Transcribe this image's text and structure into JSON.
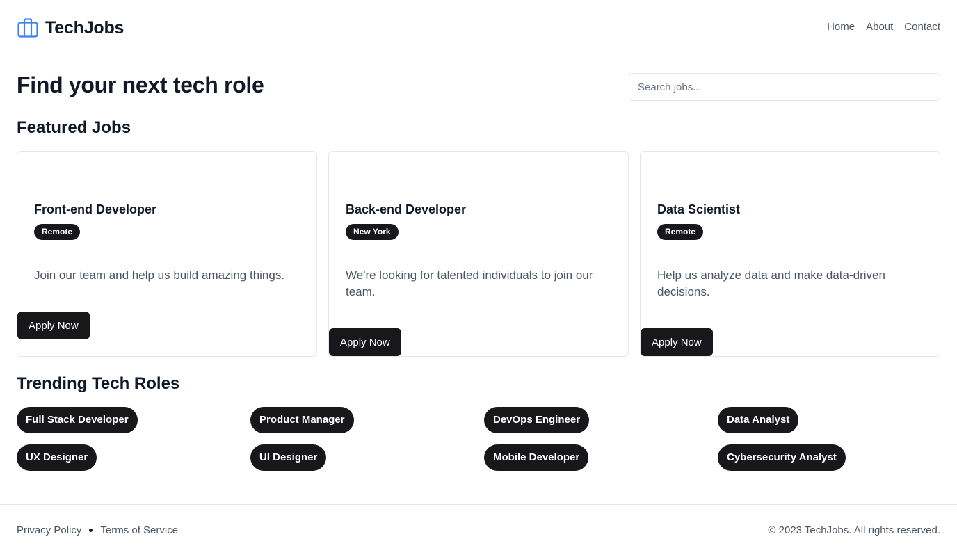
{
  "header": {
    "brand": "TechJobs",
    "brand_icon": "briefcase-icon",
    "nav": [
      "Home",
      "About",
      "Contact"
    ]
  },
  "hero": {
    "title": "Find your next tech role",
    "search_placeholder": "Search jobs..."
  },
  "featured": {
    "title": "Featured Jobs",
    "jobs": [
      {
        "title": "Front-end Developer",
        "location": "Remote",
        "description": "Join our team and help us build amazing things.",
        "button": "Apply Now"
      },
      {
        "title": "Back-end Developer",
        "location": "New York",
        "description": "We're looking for talented individuals to join our team.",
        "button": "Apply Now"
      },
      {
        "title": "Data Scientist",
        "location": "Remote",
        "description": "Help us analyze data and make data-driven decisions.",
        "button": "Apply Now"
      }
    ]
  },
  "trending": {
    "title": "Trending Tech Roles",
    "roles": [
      "Full Stack Developer",
      "Product Manager",
      "DevOps Engineer",
      "Data Analyst",
      "UX Designer",
      "UI Designer",
      "Mobile Developer",
      "Cybersecurity Analyst"
    ]
  },
  "footer": {
    "links": [
      "Privacy Policy",
      "Terms of Service"
    ],
    "copyright": "© 2023 TechJobs. All rights reserved."
  },
  "colors": {
    "brand_icon": "#3b82f6",
    "primary": "#18181b",
    "text": "#111827",
    "muted": "#4b5563",
    "border": "#e5e7eb"
  }
}
